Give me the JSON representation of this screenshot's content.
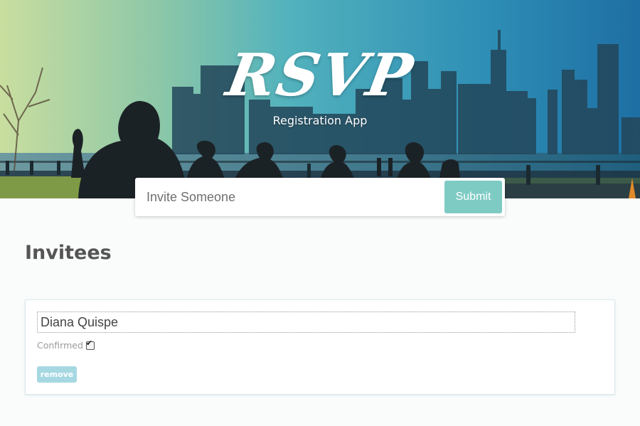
{
  "header": {
    "logo_text": "RSVP",
    "subtitle": "Registration App"
  },
  "invite_form": {
    "placeholder": "Invite Someone",
    "value": "",
    "submit_label": "Submit"
  },
  "main": {
    "section_title": "Invitees",
    "invitees": [
      {
        "name": "Diana Quispe",
        "confirmed_label": "Confirmed",
        "confirmed": true,
        "remove_label": "remove"
      }
    ]
  },
  "colors": {
    "accent": "#7ecbc4",
    "remove_button": "#a6d8e2",
    "hero_gradient": [
      "#c9de9f",
      "#4ab0c0",
      "#1d6fa3"
    ]
  }
}
